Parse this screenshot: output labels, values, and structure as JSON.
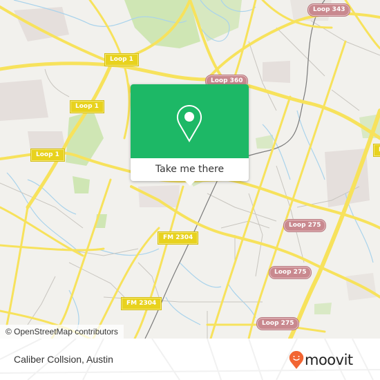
{
  "map": {
    "road_labels": [
      {
        "text": "Loop 1",
        "style": "yellow"
      },
      {
        "text": "Loop 1",
        "style": "yellow"
      },
      {
        "text": "Loop 1",
        "style": "yellow"
      },
      {
        "text": "Loop 360",
        "style": "pink"
      },
      {
        "text": "Loop 343",
        "style": "pink"
      },
      {
        "text": "FM 2304",
        "style": "yellow"
      },
      {
        "text": "FM 2304",
        "style": "yellow"
      },
      {
        "text": "Loop 275",
        "style": "pink"
      },
      {
        "text": "Loop 275",
        "style": "pink"
      },
      {
        "text": "Loop 275",
        "style": "pink"
      },
      {
        "text": "I",
        "style": "yellow"
      }
    ],
    "colors": {
      "land": "#f2f1ed",
      "major_road": "#f7e25c",
      "minor_road": "#c8c5bf",
      "water": "#a9d3ec",
      "park": "#cfe6b4",
      "building_area": "#e5dfdc",
      "rail": "#7a7a7a"
    }
  },
  "popup": {
    "icon": "location-pin-icon",
    "button_label": "Take me there",
    "color": "#1db866"
  },
  "attribution": "© OpenStreetMap contributors",
  "footer": {
    "place_name": "Caliber Collsion, Austin",
    "brand": "moovit",
    "brand_icon": "moovit-smiley-pin-icon",
    "brand_color": "#f26532"
  }
}
